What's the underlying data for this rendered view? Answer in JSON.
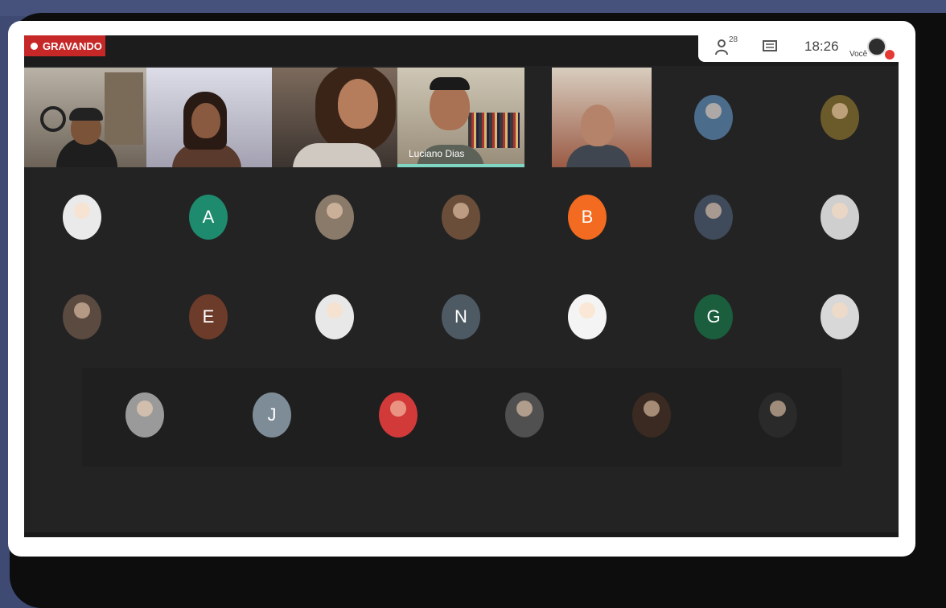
{
  "recording": {
    "label": "GRAVANDO",
    "color": "#c62828"
  },
  "info_panel": {
    "participants_count": "28",
    "participants_icon": "people-icon",
    "chat_icon": "chat-icon",
    "time": "18:26",
    "self_label": "Você",
    "notification_color": "#e53935"
  },
  "video_tiles": [
    {
      "id": "tile-1",
      "name": "",
      "active": false
    },
    {
      "id": "tile-2",
      "name": "",
      "active": false
    },
    {
      "id": "tile-3",
      "name": "",
      "active": false
    },
    {
      "id": "tile-4",
      "name": "Luciano Dias",
      "active": true
    },
    {
      "id": "tile-5",
      "name": "",
      "active": false
    }
  ],
  "avatars": {
    "row1": [
      {
        "type": "photo"
      },
      {
        "type": "photo"
      }
    ],
    "row2": [
      {
        "type": "photo"
      },
      {
        "type": "initial",
        "initial": "A",
        "color": "#1e8a6e"
      },
      {
        "type": "photo"
      },
      {
        "type": "photo"
      },
      {
        "type": "initial",
        "initial": "B",
        "color": "#f26b21"
      },
      {
        "type": "photo"
      },
      {
        "type": "photo"
      }
    ],
    "row3": [
      {
        "type": "photo"
      },
      {
        "type": "initial",
        "initial": "E",
        "color": "#6d3b2a"
      },
      {
        "type": "photo"
      },
      {
        "type": "initial",
        "initial": "N",
        "color": "#4e5a63"
      },
      {
        "type": "photo"
      },
      {
        "type": "initial",
        "initial": "G",
        "color": "#1b5e3e"
      },
      {
        "type": "photo"
      }
    ],
    "row4": [
      {
        "type": "photo"
      },
      {
        "type": "initial",
        "initial": "J",
        "color": "#7d8c97"
      },
      {
        "type": "photo"
      },
      {
        "type": "photo"
      },
      {
        "type": "photo"
      },
      {
        "type": "photo"
      }
    ]
  },
  "colors": {
    "background": "#232323",
    "active_speaker": "#7fd6c2"
  }
}
